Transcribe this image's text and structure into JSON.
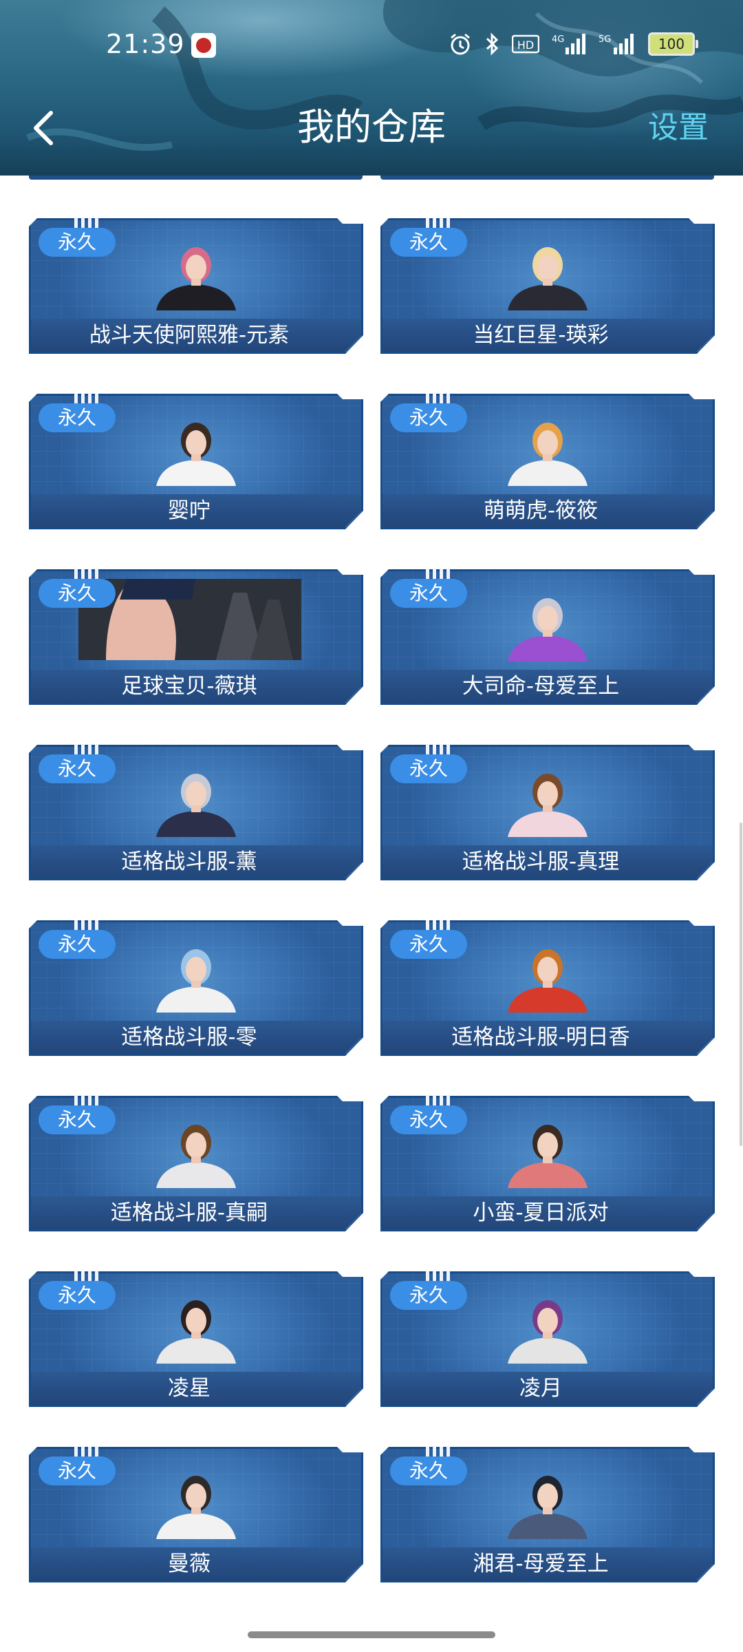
{
  "status_bar": {
    "time": "21:39",
    "hd_label": "HD",
    "net1_label": "4G",
    "net2_label": "5G",
    "battery": "100"
  },
  "header": {
    "title": "我的仓库",
    "settings_label": "设置",
    "back_icon": "chevron-left-icon"
  },
  "colors": {
    "accent": "#5fd3ef",
    "card_blue": "#3a72b2",
    "tag_blue": "#3a8ee6",
    "label_bar": "#22467a"
  },
  "items": [
    {
      "tag": "永久",
      "name": "战斗天使阿熙雅-元素"
    },
    {
      "tag": "永久",
      "name": "当红巨星-瑛彩"
    },
    {
      "tag": "永久",
      "name": "婴咛"
    },
    {
      "tag": "永久",
      "name": "萌萌虎-筱筱"
    },
    {
      "tag": "永久",
      "name": "足球宝贝-薇琪"
    },
    {
      "tag": "永久",
      "name": "大司命-母爱至上"
    },
    {
      "tag": "永久",
      "name": "适格战斗服-薰"
    },
    {
      "tag": "永久",
      "name": "适格战斗服-真理"
    },
    {
      "tag": "永久",
      "name": "适格战斗服-零"
    },
    {
      "tag": "永久",
      "name": "适格战斗服-明日香"
    },
    {
      "tag": "永久",
      "name": "适格战斗服-真嗣"
    },
    {
      "tag": "永久",
      "name": "小蛮-夏日派对"
    },
    {
      "tag": "永久",
      "name": "凌星"
    },
    {
      "tag": "永久",
      "name": "凌月"
    },
    {
      "tag": "永久",
      "name": "曼薇"
    },
    {
      "tag": "永久",
      "name": "湘君-母爱至上"
    }
  ]
}
